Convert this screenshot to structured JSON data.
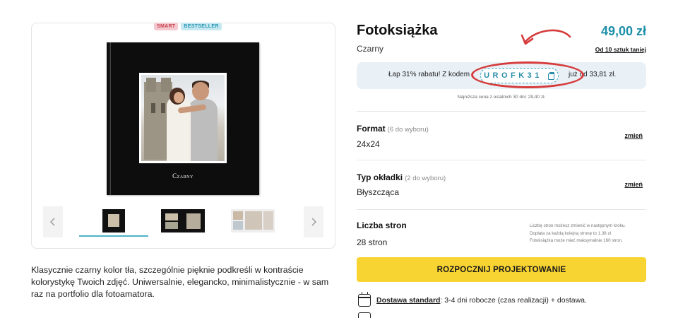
{
  "badges": {
    "smart": "SMART",
    "bestseller": "BESTSELLER"
  },
  "book": {
    "cover_title": "Czarny"
  },
  "gallery": {
    "prev_icon": "chevron-left-icon",
    "next_icon": "chevron-right-icon",
    "thumbnail_count": 3,
    "selected_thumbnail": 1
  },
  "description": "Klasycznie czarny kolor tła, szczególnie pięknie podkreśli w kontraście kolorystykę Twoich zdjęć. Uniwersalnie, elegancko, minimalistycznie - w sam raz na portfolio dla fotoamatora.",
  "product": {
    "title": "Fotoksiążka",
    "variant": "Czarny",
    "price": "49,00 zł",
    "cheaper_link": "Od 10 sztuk taniej"
  },
  "promo": {
    "text_before": "Łap 31% rabatu! Z kodem",
    "code": "UROFK31",
    "text_after": "już od 33,81 zł.",
    "copy_icon": "copy-icon",
    "lowest_price_note": "Najniższa cena z ostatnich 30 dni: 29,40 zł."
  },
  "options": {
    "format": {
      "label": "Format",
      "count": "(6 do wyboru)",
      "value": "24x24",
      "change": "zmień"
    },
    "cover": {
      "label": "Typ okładki",
      "count": "(2 do wyboru)",
      "value": "Błyszcząca",
      "change": "zmień"
    },
    "pages": {
      "label": "Liczba stron",
      "value": "28 stron",
      "note1": "Liczbę stron możesz zmienić w następnym kroku.",
      "note2": "Dopłata za każdą kolejną stronę to 1,38 zł.",
      "note3": "Fotoksiążka może mieć maksymalnie 160 stron."
    }
  },
  "cta": {
    "label": "ROZPOCZNIJ PROJEKTOWANIE"
  },
  "delivery": {
    "icon": "calendar-icon",
    "link": "Dostawa standard",
    "text": ": 3-4 dni robocze (czas realizacji) + dostawa."
  },
  "colors": {
    "accent": "#1e8fa8",
    "cta": "#f8d433",
    "annotation": "#d63b3b",
    "promo_bg": "#e9f1f7"
  }
}
